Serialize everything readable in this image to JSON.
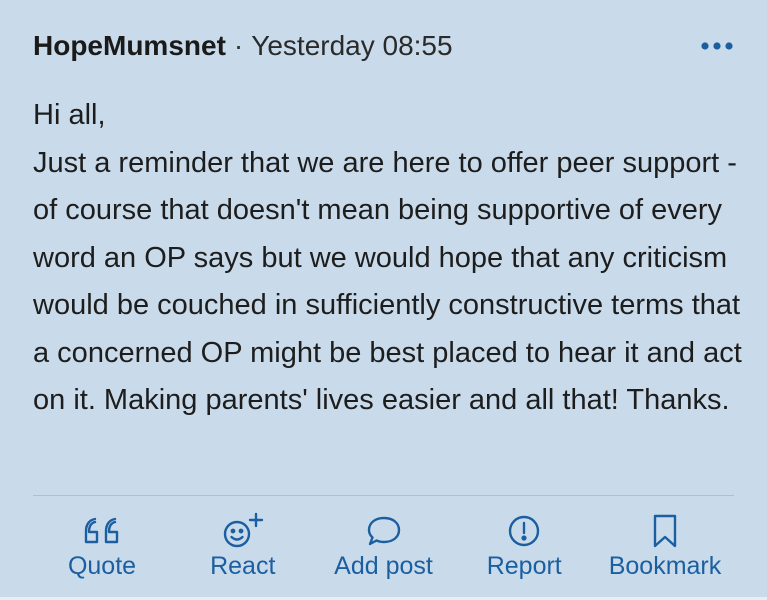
{
  "post": {
    "author": "HopeMumsnet",
    "separator": "·",
    "timestamp": "Yesterday 08:55",
    "more_icon": "ellipsis-icon",
    "body": "Hi all,\nJust a reminder that we are here to offer peer support - of course that doesn't mean being supportive of every word an OP says but we would hope that any criticism would be couched in sufficiently constructive terms that a concerned OP might be best placed to hear it and act on it. Making parents' lives easier and all that! Thanks."
  },
  "actions": [
    {
      "label": "Quote",
      "icon": "quote-icon"
    },
    {
      "label": "React",
      "icon": "smiley-plus-icon"
    },
    {
      "label": "Add post",
      "icon": "speech-bubble-icon"
    },
    {
      "label": "Report",
      "icon": "exclamation-circle-icon"
    },
    {
      "label": "Bookmark",
      "icon": "bookmark-icon"
    }
  ],
  "colors": {
    "background": "#c9dbeb",
    "accent": "#1c5fa0",
    "text": "#1d1d1d"
  }
}
